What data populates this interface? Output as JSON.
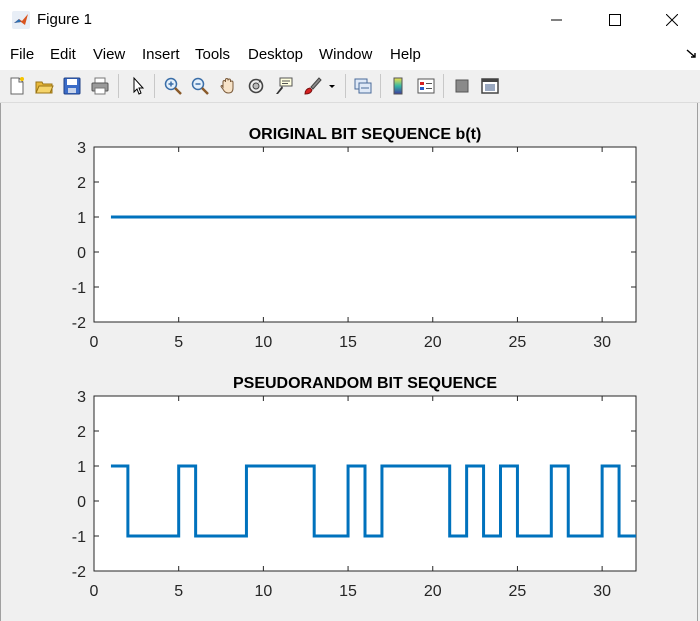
{
  "window": {
    "title": "Figure 1"
  },
  "menu": [
    {
      "label": "File"
    },
    {
      "label": "Edit"
    },
    {
      "label": "View"
    },
    {
      "label": "Insert"
    },
    {
      "label": "Tools"
    },
    {
      "label": "Desktop"
    },
    {
      "label": "Window"
    },
    {
      "label": "Help"
    }
  ],
  "toolbar": {
    "icons": [
      "new-figure-icon",
      "open-file-icon",
      "save-icon",
      "print-icon",
      "edit-plot-arrow-icon",
      "zoom-in-icon",
      "zoom-out-icon",
      "pan-hand-icon",
      "rotate-3d-icon",
      "data-cursor-icon",
      "brush-icon",
      "brush-dropdown-icon",
      "link-plot-icon",
      "insert-colorbar-icon",
      "insert-legend-icon",
      "hide-plot-tools-icon",
      "show-plot-tools-icon"
    ]
  },
  "colors": {
    "line": "#0072BD",
    "axes_bg": "#ffffff",
    "figure_bg": "#f0f0f0"
  },
  "chart_data": [
    {
      "type": "line",
      "title": "ORIGINAL BIT SEQUENCE b(t)",
      "xlabel": "",
      "ylabel": "",
      "xlim": [
        0,
        32
      ],
      "ylim": [
        -2,
        3
      ],
      "xticks": [
        0,
        5,
        10,
        15,
        20,
        25,
        30
      ],
      "yticks": [
        -2,
        -1,
        0,
        1,
        2,
        3
      ],
      "grid": false,
      "series": [
        {
          "x": [
            1,
            32
          ],
          "y": [
            1,
            1
          ]
        }
      ]
    },
    {
      "type": "line",
      "title": "PSEUDORANDOM BIT SEQUENCE",
      "xlabel": "",
      "ylabel": "",
      "xlim": [
        0,
        32
      ],
      "ylim": [
        -2,
        3
      ],
      "xticks": [
        0,
        5,
        10,
        15,
        20,
        25,
        30
      ],
      "yticks": [
        -2,
        -1,
        0,
        1,
        2,
        3
      ],
      "grid": false,
      "series": [
        {
          "x": [
            1,
            2,
            2,
            5,
            5,
            6,
            6,
            9,
            9,
            13,
            13,
            15,
            15,
            16,
            16,
            17,
            17,
            21,
            21,
            22,
            22,
            23,
            23,
            24,
            24,
            25,
            25,
            27,
            27,
            28,
            28,
            30,
            30,
            31,
            31,
            32
          ],
          "y": [
            1,
            1,
            -1,
            -1,
            1,
            1,
            -1,
            -1,
            1,
            1,
            -1,
            -1,
            1,
            1,
            -1,
            -1,
            1,
            1,
            -1,
            -1,
            1,
            1,
            -1,
            -1,
            1,
            1,
            -1,
            -1,
            1,
            1,
            -1,
            -1,
            1,
            1,
            -1,
            -1
          ]
        }
      ]
    }
  ]
}
